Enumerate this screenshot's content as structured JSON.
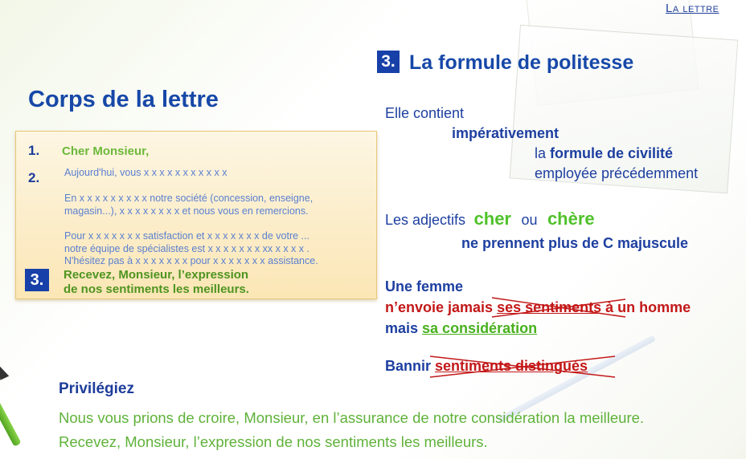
{
  "header": {
    "link": "La lettre"
  },
  "left": {
    "title": "Corps de la lettre",
    "letter": {
      "num1": "1.",
      "salutation": "Cher Monsieur,",
      "num2": "2.",
      "para1": "Aujourd'hui, vous x x x x x x x x x x x",
      "para2_line1": "En x x x x x x x x x notre société (concession, enseigne,",
      "para2_line2": "magasin...), x x x x x x x x et nous vous en remercions.",
      "para3_line1": "Pour x x x x x x x satisfaction et x x x x x x x de votre ...",
      "para3_line2": "notre équipe de spécialistes est x x x x x x x xx x x x x .",
      "para3_line3": "N'hésitez pas à x x x x x x x pour x x x x x x x assistance.",
      "num3": "3.",
      "closing_line1": "Recevez, Monsieur, l’expression",
      "closing_line2": "de nos sentiments les meilleurs."
    }
  },
  "right": {
    "num": "3.",
    "title": "La formule de politesse",
    "line1": "Elle contient",
    "line2": "impérativement",
    "line3_a": "la ",
    "line3_b": "formule de civilité",
    "line4": "employée précédemment",
    "adj_a": "Les adjectifs",
    "adj_cher": "cher",
    "adj_ou": "ou",
    "adj_chere": "chère",
    "adj_rule": "ne prennent plus de C majuscule",
    "femme1": "Une femme",
    "femme2_a": "n’envoie jamais ",
    "femme2_strike": "ses sentiments",
    "femme2_c": " à un homme",
    "femme3_a": "mais ",
    "femme3_b": "sa considération",
    "bannir_a": "Bannir ",
    "bannir_b": "sentiments distingués"
  },
  "bottom": {
    "label": "Privilégiez",
    "example1": "Nous vous prions de croire, Monsieur, en l’assurance de notre considération la meilleure.",
    "example2": "Recevez, Monsieur, l’expression de nos sentiments les meilleurs."
  },
  "colors": {
    "navy": "#1748a8",
    "green": "#4fc22a",
    "red": "#c31818",
    "box": "#fbe6b5"
  }
}
